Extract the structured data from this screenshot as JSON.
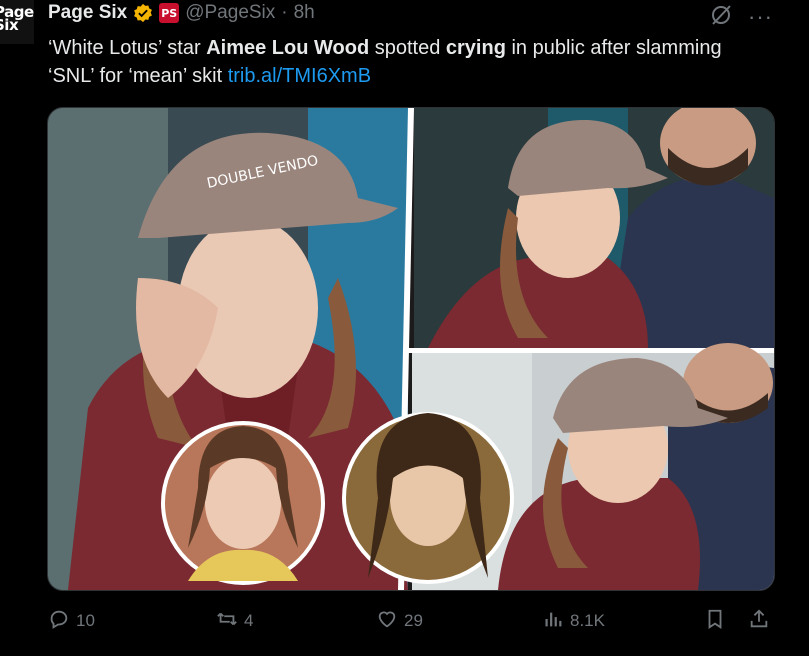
{
  "account": {
    "avatar_text": "Page Six",
    "display_name": "Page Six",
    "affiliate_badge": "PS",
    "handle": "@PageSix",
    "separator": "·",
    "time": "8h"
  },
  "tweet": {
    "segments": [
      {
        "text": "‘White Lotus’ star ",
        "bold": false
      },
      {
        "text": "Aimee Lou Wood",
        "bold": true
      },
      {
        "text": " spotted ",
        "bold": false
      },
      {
        "text": "crying",
        "bold": true
      },
      {
        "text": " in public after slamming ‘SNL’ for ‘mean’ skit ",
        "bold": false
      }
    ],
    "link": "trib.al/TMI6XmB"
  },
  "media": {
    "cap_text": "DOUBLE VENDO",
    "colors": {
      "jacket": "#7a2a30",
      "cap": "#9a857c",
      "bg": "#2d3a40",
      "hoodie": "#2b3550"
    }
  },
  "actions": {
    "reply_count": "10",
    "repost_count": "4",
    "like_count": "29",
    "views_count": "8.1K"
  },
  "icons": [
    "verified-badge-icon",
    "grok-icon",
    "more-icon",
    "reply-icon",
    "repost-icon",
    "like-icon",
    "views-icon",
    "bookmark-icon",
    "share-icon"
  ],
  "colors": {
    "background": "#000000",
    "text": "#e7e9ea",
    "muted": "#71767b",
    "link": "#1d9bf0",
    "verified": "#f4b400"
  }
}
